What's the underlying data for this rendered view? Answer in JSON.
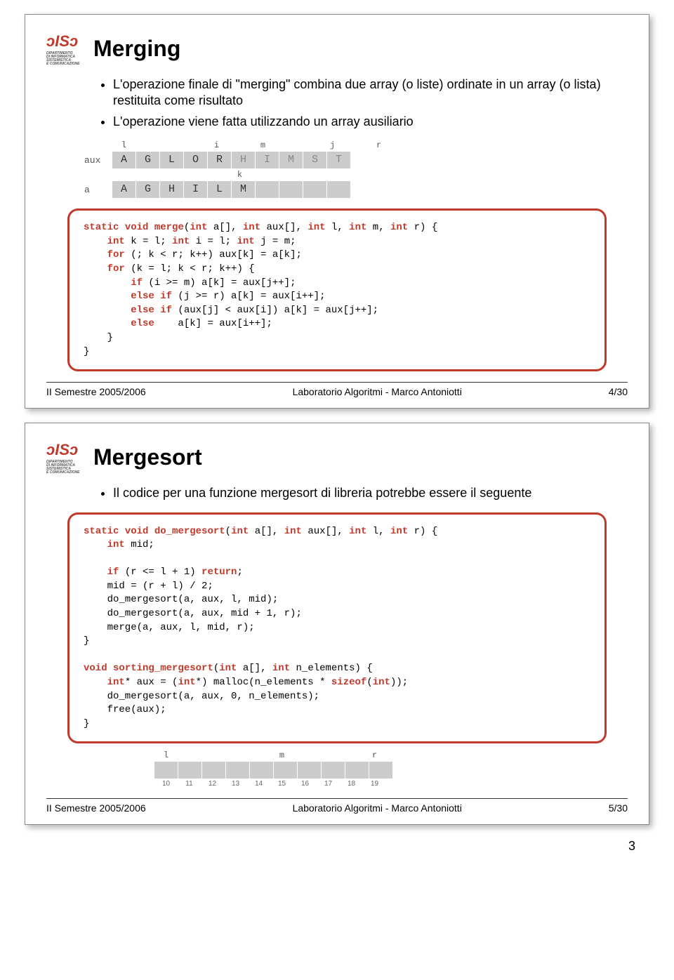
{
  "slide1": {
    "title": "Merging",
    "bullets": [
      "L'operazione finale di \"merging\" combina due array (o liste) ordinate in un array (o lista) restituita come risultato",
      "L'operazione viene fatta utilizzando un array ausiliario"
    ],
    "vis": {
      "top_idx": [
        "l",
        "",
        "",
        "",
        "i",
        "",
        "m",
        "",
        "",
        "j",
        "",
        "r"
      ],
      "aux_lbl": "aux",
      "aux_cells": [
        "A",
        "G",
        "L",
        "O",
        "R",
        "H",
        "I",
        "M",
        "S",
        "T"
      ],
      "k_idx": [
        "",
        "",
        "",
        "",
        "",
        "k",
        "",
        "",
        "",
        "",
        "",
        ""
      ],
      "a_lbl": "a",
      "a_cells": [
        "A",
        "G",
        "H",
        "I",
        "L",
        "M",
        "",
        "",
        "",
        ""
      ]
    },
    "code": [
      [
        "kw:static",
        " ",
        "kw:void",
        " ",
        "fn:merge",
        "(",
        "kw:int",
        " a[], ",
        "kw:int",
        " aux[], ",
        "kw:int",
        " l, ",
        "kw:int",
        " m, ",
        "kw:int",
        " r) {"
      ],
      [
        "    ",
        "kw:int",
        " k = l; ",
        "kw:int",
        " i = l; ",
        "kw:int",
        " j = m;"
      ],
      [
        "    ",
        "kw:for",
        " (; k < r; k++) aux[k] = a[k];"
      ],
      [
        "    ",
        "kw:for",
        " (k = l; k < r; k++) {"
      ],
      [
        "        ",
        "kw:if",
        " (i >= m) a[k] = aux[j++];"
      ],
      [
        "        ",
        "kw:else if",
        " (j >= r) a[k] = aux[i++];"
      ],
      [
        "        ",
        "kw:else if",
        " (aux[j] < aux[i]) a[k] = aux[j++];"
      ],
      [
        "        ",
        "kw:else",
        "    a[k] = aux[i++];"
      ],
      [
        "    }"
      ],
      [
        "}"
      ]
    ],
    "footer": {
      "l": "II Semestre 2005/2006",
      "c": "Laboratorio Algoritmi - Marco Antoniotti",
      "r": "4/30"
    }
  },
  "slide2": {
    "title": "Mergesort",
    "bullets": [
      "Il codice per una funzione mergesort di libreria potrebbe essere il seguente"
    ],
    "code": [
      [
        "kw:static",
        " ",
        "kw:void",
        " ",
        "fn:do_mergesort",
        "(",
        "kw:int",
        " a[], ",
        "kw:int",
        " aux[], ",
        "kw:int",
        " l, ",
        "kw:int",
        " r) {"
      ],
      [
        "    ",
        "kw:int",
        " mid;"
      ],
      [
        ""
      ],
      [
        "    ",
        "kw:if",
        " (r <= l + 1) ",
        "kw:return",
        ";"
      ],
      [
        "    mid = (r + l) / 2;"
      ],
      [
        "    do_mergesort(a, aux, l, mid);"
      ],
      [
        "    do_mergesort(a, aux, mid + 1, r);"
      ],
      [
        "    merge(a, aux, l, mid, r);"
      ],
      [
        "}"
      ],
      [
        ""
      ],
      [
        "kw:void",
        " ",
        "fn:sorting_mergesort",
        "(",
        "kw:int",
        " a[], ",
        "kw:int",
        " n_elements) {"
      ],
      [
        "    ",
        "kw:int",
        "* aux = (",
        "kw:int",
        "*) malloc(n_elements * ",
        "kw:sizeof",
        "(",
        "kw:int",
        "));"
      ],
      [
        "    do_mergesort(a, aux, 0, n_elements);"
      ],
      [
        "    free(aux);"
      ],
      [
        "}"
      ]
    ],
    "vis": {
      "idx": [
        "l",
        "",
        "",
        "",
        "",
        "m",
        "",
        "",
        "",
        "r"
      ],
      "cells": [
        "",
        "",
        "",
        "",
        "",
        "",
        "",
        "",
        "",
        ""
      ],
      "ticks": [
        "10",
        "11",
        "12",
        "13",
        "14",
        "15",
        "16",
        "17",
        "18",
        "19"
      ]
    },
    "footer": {
      "l": "II Semestre 2005/2006",
      "c": "Laboratorio Algoritmi - Marco Antoniotti",
      "r": "5/30"
    }
  },
  "pagenum": "3"
}
